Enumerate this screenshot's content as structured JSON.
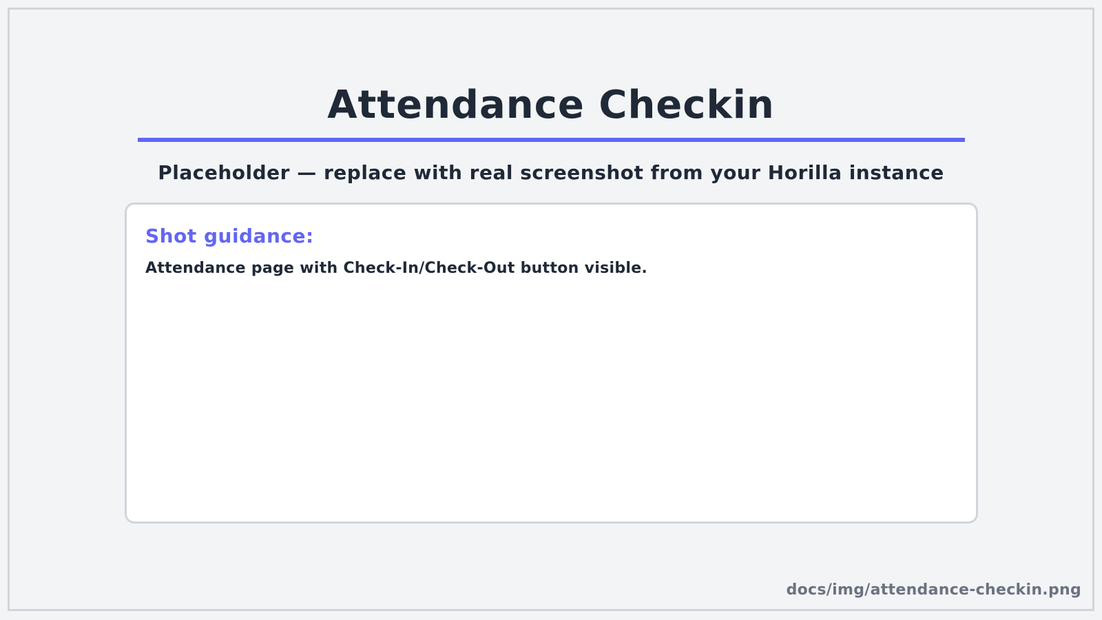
{
  "page": {
    "title": "Attendance Checkin",
    "subtitle": "Placeholder — replace with real screenshot from your Horilla instance"
  },
  "guidance": {
    "heading": "Shot guidance:",
    "text": "Attendance page with Check-In/Check-Out button visible."
  },
  "footer": {
    "path": "docs/img/attendance-checkin.png"
  },
  "colors": {
    "accent": "#6366f1",
    "text": "#1f2937",
    "muted": "#6b7280",
    "border": "#d1d5db",
    "background": "#f3f4f6",
    "card": "#ffffff"
  }
}
